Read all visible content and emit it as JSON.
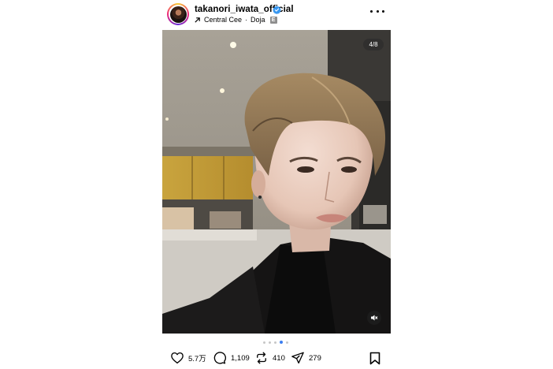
{
  "post": {
    "username": "takanori_iwata_official",
    "verified": true,
    "music": {
      "artist": "Central Cee",
      "separator": "·",
      "track": "Doja",
      "explicit_badge": "E"
    },
    "media": {
      "counter": "4/8",
      "current_index": 4,
      "total": 8
    },
    "actions": {
      "likes": "5.7万",
      "comments": "1,109",
      "reposts": "410",
      "shares": "279"
    },
    "icons": {
      "more": "more-horizontal-icon",
      "like": "heart-icon",
      "comment": "comment-icon",
      "repost": "repost-icon",
      "share": "send-icon",
      "save": "bookmark-icon",
      "mute": "speaker-muted-icon",
      "music": "arrow-up-right-icon"
    },
    "colors": {
      "verified": "#3897f0",
      "active_dot": "#3c7ef0",
      "inactive_dot": "#c7c7c7"
    }
  }
}
